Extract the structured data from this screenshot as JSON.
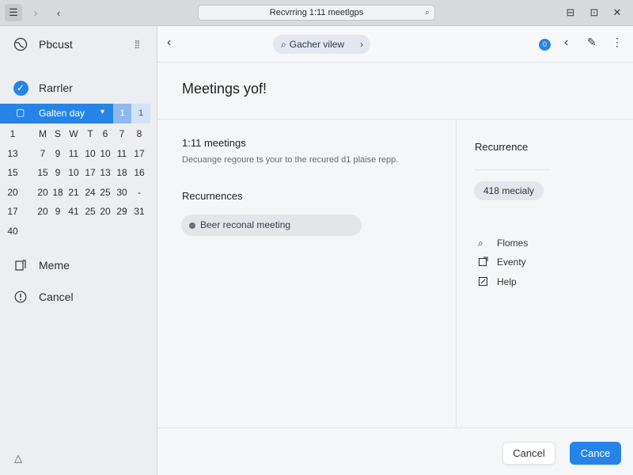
{
  "titlebar": {
    "title": "Recvrring 1:11 meetlgps",
    "icons": [
      "menu-icon",
      "forward-icon",
      "back-icon",
      "search-icon",
      "minimize-icon",
      "maximize-icon",
      "close-icon"
    ]
  },
  "sidebar": {
    "header_label": "Pbcust",
    "reminder_label": "Rarrler",
    "calendar": {
      "selected_label": "Galten day",
      "badge1": "1",
      "badge2": "1",
      "rows": [
        [
          "1",
          "M",
          "S",
          "W",
          "T",
          "6",
          "7",
          "8"
        ],
        [
          "13",
          "7",
          "9",
          "11",
          "10",
          "10",
          "11",
          "17"
        ],
        [
          "15",
          "15",
          "9",
          "10",
          "17",
          "13",
          "18",
          "16"
        ],
        [
          "20",
          "20",
          "18",
          "21",
          "24",
          "25",
          "30",
          "-"
        ],
        [
          "17",
          "20",
          "9",
          "41",
          "25",
          "20",
          "29",
          "31"
        ],
        [
          "40"
        ]
      ]
    },
    "items": [
      {
        "label": "Meme",
        "icon": "note-icon"
      },
      {
        "label": "Cancel",
        "icon": "alert-icon"
      }
    ]
  },
  "main": {
    "toolbar": {
      "search_label": "Gacher vilew",
      "badge": "0"
    },
    "title": "Meetings yof!",
    "section1_title": "1:11 meetings",
    "section1_desc": "Decuange regoure ts your to the recured d1 plaise repp.",
    "section2_title": "Recurnences",
    "chip_label": "Beer reconal meeting",
    "right_panel": {
      "title": "Recurrence",
      "pill": "418 mecialy",
      "items": [
        {
          "label": "Flomes",
          "icon": "search-icon"
        },
        {
          "label": "Eventy",
          "icon": "export-icon"
        },
        {
          "label": "Help",
          "icon": "edit-icon"
        }
      ]
    },
    "footer": {
      "cancel_label": "Cancel",
      "primary_label": "Cance"
    }
  },
  "colors": {
    "accent": "#2684e8"
  }
}
